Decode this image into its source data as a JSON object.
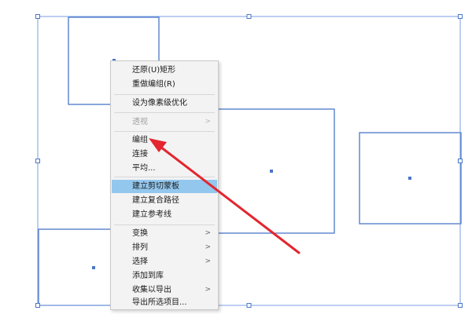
{
  "menu": {
    "items": [
      {
        "label": "还原(U)矩形"
      },
      {
        "label": "重做编组(R)"
      },
      {
        "label": "设为像素级优化"
      },
      {
        "label": "透视",
        "disabled": true,
        "submenu": true
      },
      {
        "label": "编组"
      },
      {
        "label": "连接"
      },
      {
        "label": "平均..."
      },
      {
        "label": "建立剪切蒙板",
        "highlighted": true
      },
      {
        "label": "建立复合路径"
      },
      {
        "label": "建立参考线"
      },
      {
        "label": "变换",
        "submenu": true
      },
      {
        "label": "排列",
        "submenu": true
      },
      {
        "label": "选择",
        "submenu": true
      },
      {
        "label": "添加到库"
      },
      {
        "label": "收集以导出",
        "submenu": true
      },
      {
        "label": "导出所选项目..."
      }
    ]
  },
  "colors": {
    "selection": "#4a76c9",
    "menu_highlight": "#93c7ee",
    "arrow": "#e3262f"
  }
}
